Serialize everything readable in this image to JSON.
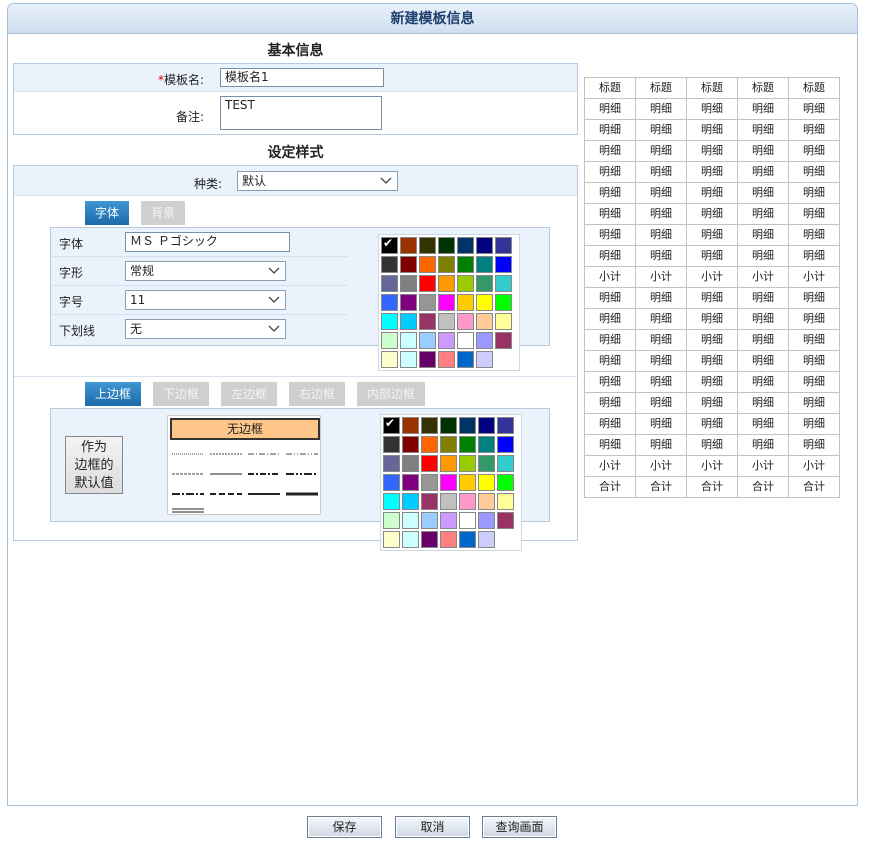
{
  "window": {
    "title": "新建模板信息"
  },
  "basic": {
    "section_title": "基本信息",
    "required_mark": "*",
    "name_label": "模板名:",
    "name_value": "模板名1",
    "remark_label": "备注:",
    "remark_value": "TEST"
  },
  "style": {
    "section_title": "设定样式",
    "kind_label": "种类:",
    "kind_value": "默认",
    "font_tabs": [
      {
        "label": "字体",
        "active": true
      },
      {
        "label": "背景",
        "active": false
      }
    ],
    "font_rows": [
      {
        "label": "字体",
        "value": "ＭＳ Ｐゴシック",
        "type": "text"
      },
      {
        "label": "字形",
        "value": "常规",
        "type": "select"
      },
      {
        "label": "字号",
        "value": "11",
        "type": "select"
      },
      {
        "label": "下划线",
        "value": "无",
        "type": "select"
      }
    ],
    "border_tabs": [
      {
        "label": "上边框",
        "active": true
      },
      {
        "label": "下边框",
        "active": false
      },
      {
        "label": "左边框",
        "active": false
      },
      {
        "label": "右边框",
        "active": false
      },
      {
        "label": "内部边框",
        "active": false
      }
    ],
    "default_border_btn": "作为\n边框的\n默认值",
    "no_border_label": "无边框",
    "palette": [
      "#000000",
      "#993300",
      "#333300",
      "#003300",
      "#003366",
      "#000080",
      "#333399",
      "#333333",
      "#800000",
      "#ff6600",
      "#808000",
      "#008000",
      "#008080",
      "#0000ff",
      "#666699",
      "#808080",
      "#ff0000",
      "#ff9900",
      "#99cc00",
      "#339966",
      "#33cccc",
      "#3366ff",
      "#800080",
      "#969696",
      "#ff00ff",
      "#ffcc00",
      "#ffff00",
      "#00ff00",
      "#00ffff",
      "#00ccff",
      "#993366",
      "#c0c0c0",
      "#ff99cc",
      "#ffcc99",
      "#ffff99",
      "#ccffcc",
      "#ccffff",
      "#99ccff",
      "#cc99ff",
      "#ffffff",
      "#9999ff",
      "#993366",
      "#ffffcc",
      "#ccffff",
      "#660066",
      "#ff8080",
      "#0066cc",
      "#ccccff"
    ]
  },
  "preview": {
    "rows": [
      [
        "标题",
        "标题",
        "标题",
        "标题",
        "标题"
      ],
      [
        "明细",
        "明细",
        "明细",
        "明细",
        "明细"
      ],
      [
        "明细",
        "明细",
        "明细",
        "明细",
        "明细"
      ],
      [
        "明细",
        "明细",
        "明细",
        "明细",
        "明细"
      ],
      [
        "明细",
        "明细",
        "明细",
        "明细",
        "明细"
      ],
      [
        "明细",
        "明细",
        "明细",
        "明细",
        "明细"
      ],
      [
        "明细",
        "明细",
        "明细",
        "明细",
        "明细"
      ],
      [
        "明细",
        "明细",
        "明细",
        "明细",
        "明细"
      ],
      [
        "明细",
        "明细",
        "明细",
        "明细",
        "明细"
      ],
      [
        "小计",
        "小计",
        "小计",
        "小计",
        "小计"
      ],
      [
        "明细",
        "明细",
        "明细",
        "明细",
        "明细"
      ],
      [
        "明细",
        "明细",
        "明细",
        "明细",
        "明细"
      ],
      [
        "明细",
        "明细",
        "明细",
        "明细",
        "明细"
      ],
      [
        "明细",
        "明细",
        "明细",
        "明细",
        "明细"
      ],
      [
        "明细",
        "明细",
        "明细",
        "明细",
        "明细"
      ],
      [
        "明细",
        "明细",
        "明细",
        "明细",
        "明细"
      ],
      [
        "明细",
        "明细",
        "明细",
        "明细",
        "明细"
      ],
      [
        "明细",
        "明细",
        "明细",
        "明细",
        "明细"
      ],
      [
        "小计",
        "小计",
        "小计",
        "小计",
        "小计"
      ],
      [
        "合计",
        "合计",
        "合计",
        "合计",
        "合计"
      ]
    ]
  },
  "footer": {
    "save": "保存",
    "cancel": "取消",
    "query": "查询画面"
  }
}
